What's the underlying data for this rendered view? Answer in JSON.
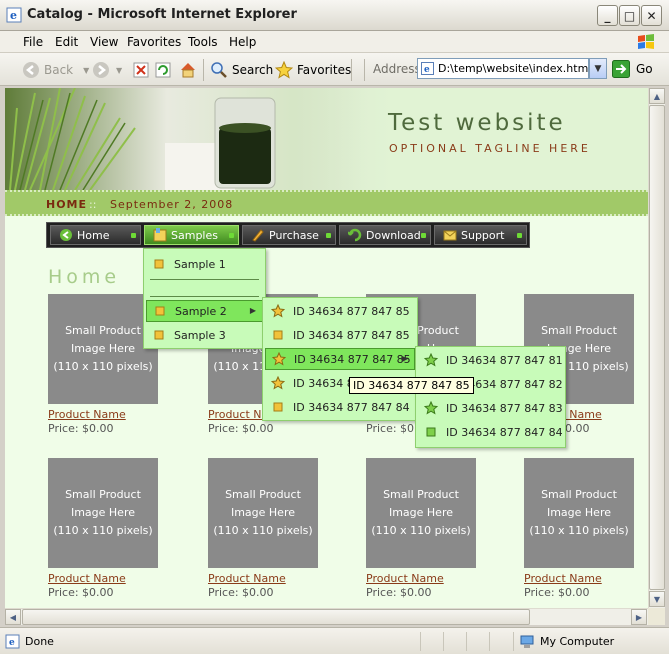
{
  "window": {
    "title": "Catalog - Microsoft Internet Explorer",
    "controls": {
      "minimize": "_",
      "maximize": "□",
      "close": "✕"
    }
  },
  "menubar": [
    "File",
    "Edit",
    "View",
    "Favorites",
    "Tools",
    "Help"
  ],
  "toolbar": {
    "back_label": "Back",
    "search_label": "Search",
    "favorites_label": "Favorites",
    "address_label": "Address",
    "address_value": "D:\\temp\\website\\index.html",
    "go_label": "Go"
  },
  "site": {
    "title": "Test website",
    "tagline": "OPTIONAL TAGLINE HERE",
    "home_link": "HOME",
    "date_separator": "::",
    "date": "September 2, 2008",
    "heading": "Home"
  },
  "nav": [
    {
      "label": "Home"
    },
    {
      "label": "Samples",
      "active": true
    },
    {
      "label": "Purchase"
    },
    {
      "label": "Download"
    },
    {
      "label": "Support"
    }
  ],
  "products": {
    "image_line1": "Small Product",
    "image_line2": "Image Here",
    "image_line3": "(110 x 110 pixels)",
    "name": "Product Name",
    "price": "Price: $0.00"
  },
  "menu_level1": [
    "Sample 1",
    "Sample 2",
    "Sample 3"
  ],
  "menu_level2": [
    "ID 34634 877 847 85",
    "ID 34634 877 847 85",
    "ID 34634 877 847 85",
    "ID 34634 87",
    "ID 34634 877 847 84"
  ],
  "menu_level3": [
    "ID 34634 877 847 81",
    "ID 34634 877 847 82",
    "ID 34634 877 847 83",
    "ID 34634 877 847 84"
  ],
  "tooltip": "ID 34634 877 847 85",
  "statusbar": {
    "text": "Done",
    "zone": "My Computer"
  }
}
